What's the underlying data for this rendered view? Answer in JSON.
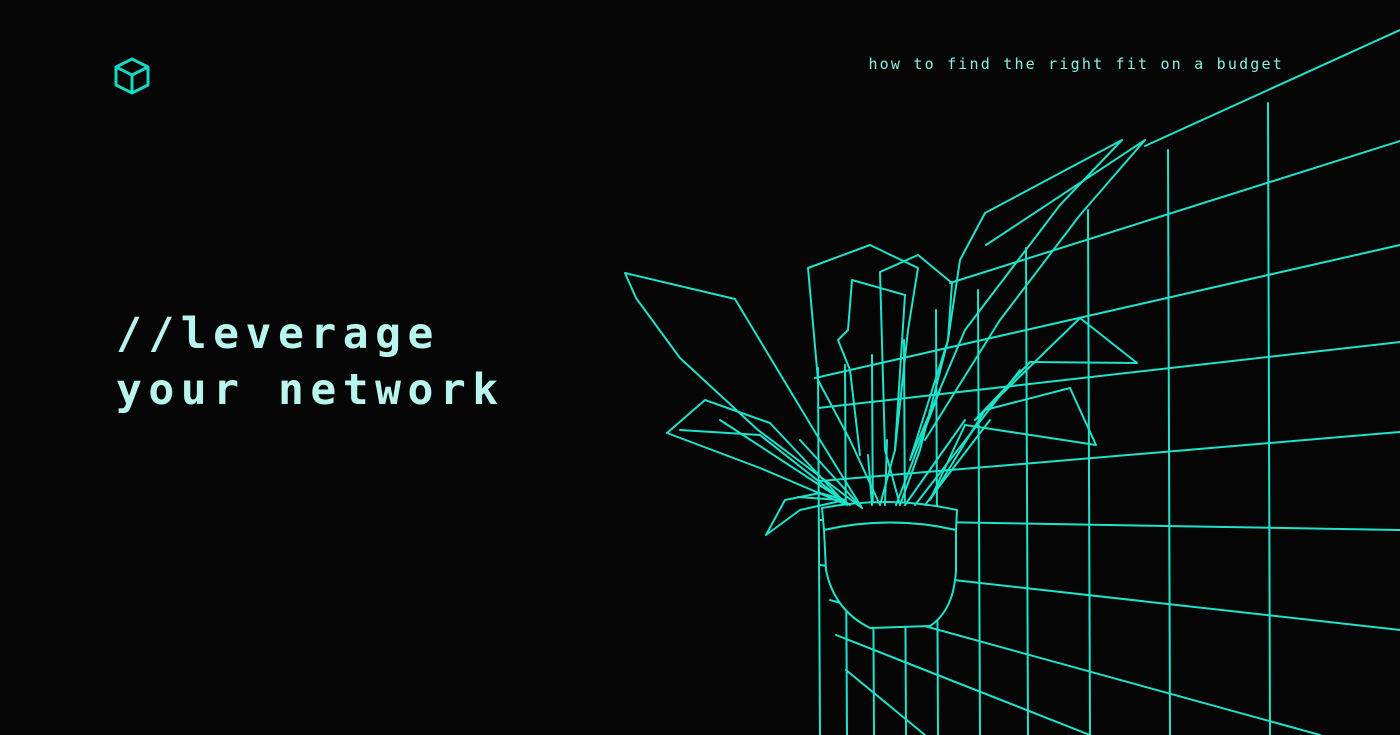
{
  "brand": {
    "logo_icon": "cube-outline-icon",
    "accent_color": "#16d9c4"
  },
  "tagline": "how to find the right fit on a budget",
  "headline": {
    "line1": "//leverage",
    "line2": "your network"
  },
  "illustration": {
    "subject": "wireframe potted plant against perspective grid wall",
    "stroke_color": "#1ee3cb"
  }
}
